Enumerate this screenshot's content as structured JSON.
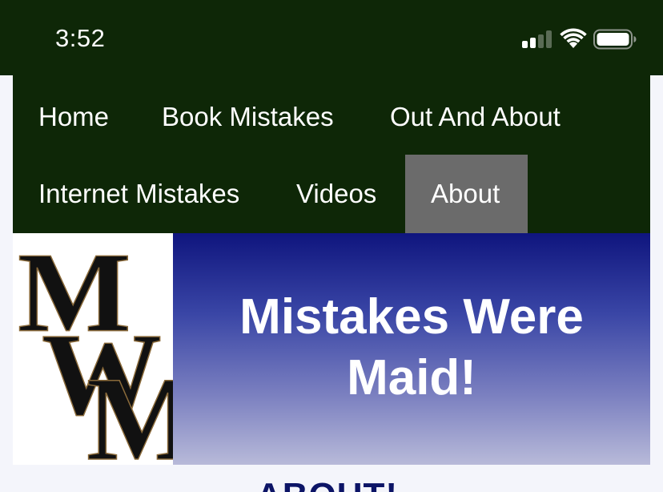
{
  "status_bar": {
    "time": "3:52",
    "icons": [
      "cellular-signal-icon",
      "wifi-icon",
      "battery-icon"
    ]
  },
  "nav": {
    "items": [
      {
        "label": "Home",
        "active": false
      },
      {
        "label": "Book Mistakes",
        "active": false
      },
      {
        "label": "Out And About",
        "active": false
      },
      {
        "label": "Internet Mistakes",
        "active": false
      },
      {
        "label": "Videos",
        "active": false
      },
      {
        "label": "About",
        "active": true
      }
    ]
  },
  "header": {
    "logo_text": "MWM",
    "title": "Mistakes Were Maid!"
  },
  "page": {
    "heading": "ABOUT!"
  },
  "colors": {
    "nav_background": "#0e2707",
    "active_tab": "#6b6b6b",
    "banner_top": "#0f157e",
    "banner_bottom": "#b8bad9",
    "heading": "#0c1466",
    "page_background": "#f4f5fb"
  }
}
